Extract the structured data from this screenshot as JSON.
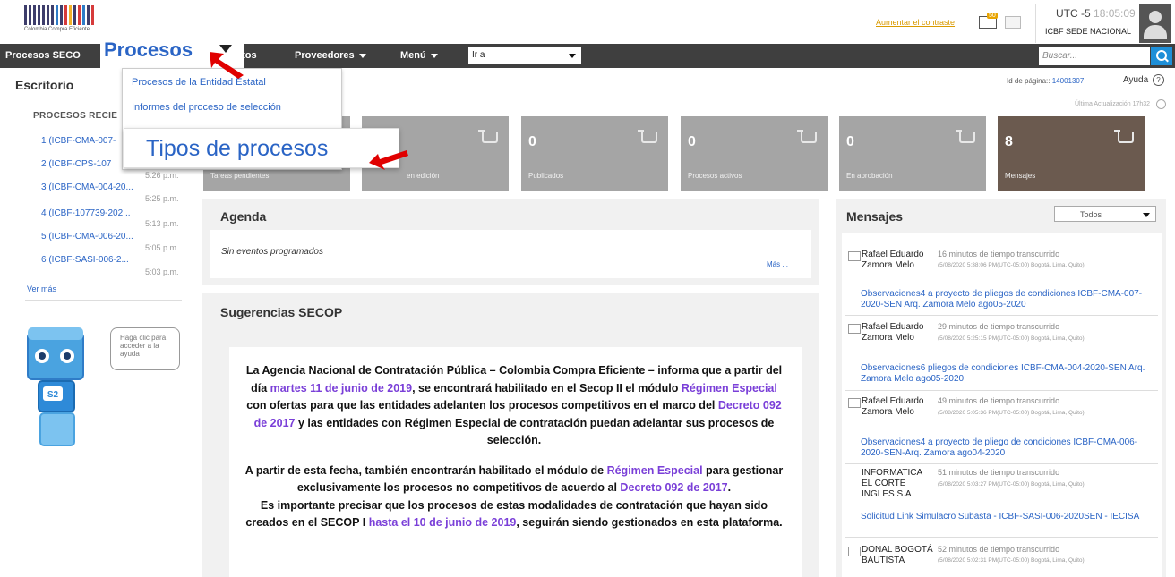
{
  "header": {
    "logo_caption": "Colombia Compra Eficiente",
    "increase_link": "Aumentar el contraste",
    "notif_badge": "50",
    "clock_main": "UTC -5",
    "clock_seconds": "18:05:09",
    "org_name": "ICBF SEDE NACIONAL"
  },
  "navbar": {
    "item_procesos_secop": "Procesos SECO",
    "item_contratos": "atos",
    "item_proveedores": "Proveedores",
    "item_menu": "Menú",
    "goto_value": "Ir a",
    "search_placeholder": "Buscar..."
  },
  "dropdown": {
    "tab_label": "Procesos",
    "items": [
      "Procesos de la Entidad Estatal",
      "Informes del proceso de selección"
    ],
    "highlight_item": "Tipos de procesos"
  },
  "sidebar": {
    "title": "Escritorio",
    "recent_title": "PROCESOS RECIE",
    "recent": [
      {
        "label": "1 (ICBF-CMA-007-",
        "time": ""
      },
      {
        "label": "2 (ICBF-CPS-107",
        "time": "5:26 p.m."
      },
      {
        "label": "3 (ICBF-CMA-004-20...",
        "time": "5:25 p.m."
      },
      {
        "label": "4 (ICBF-107739-202...",
        "time": "5:13 p.m."
      },
      {
        "label": "5 (ICBF-CMA-006-20...",
        "time": "5:05 p.m."
      },
      {
        "label": "6 (ICBF-SASI-006-2...",
        "time": "5:03 p.m."
      }
    ],
    "see_more": "Ver más",
    "help_bubble": "Haga clic para acceder a la ayuda",
    "robot_badge": "S2"
  },
  "page_meta": {
    "page_id_label": "Id de página::",
    "page_id_value": "14001307",
    "help_label": "Ayuda",
    "last_update": "Última Actualización 17h32"
  },
  "tiles": [
    {
      "num": "",
      "label": "Tareas pendientes"
    },
    {
      "num": "",
      "label": "en edición"
    },
    {
      "num": "0",
      "label": "Publicados"
    },
    {
      "num": "0",
      "label": "Procesos activos"
    },
    {
      "num": "0",
      "label": "En aprobación"
    },
    {
      "num": "8",
      "label": "Mensajes"
    }
  ],
  "agenda": {
    "title": "Agenda",
    "empty": "Sin eventos programados",
    "more": "Más ..."
  },
  "suggestions": {
    "title": "Sugerencias SECOP",
    "p1_a": "La Agencia Nacional de Contratación Pública – Colombia Compra Eficiente – informa que a partir del día ",
    "p1_h1": "martes 11 de junio de 2019",
    "p1_b": ", se encontrará habilitado en el Secop II el módulo ",
    "p1_h2": "Régimen Especial",
    "p1_c": " con ofertas para que las entidades adelanten los procesos competitivos en el marco del ",
    "p1_h3": "Decreto 092 de 2017",
    "p1_d": " y las entidades con Régimen Especial de contratación puedan adelantar sus procesos de selección.",
    "p2_a": "A partir de esta fecha, también encontrarán habilitado el módulo de ",
    "p2_h1": "Régimen Especial",
    "p2_b": " para gestionar exclusivamente los procesos no competitivos de acuerdo al ",
    "p2_h2": "Decreto 092 de 2017",
    "p2_c": ".",
    "p3_a": "Es importante precisar que los procesos de estas modalidades de contratación que hayan sido creados en el SECOP I ",
    "p3_h1": "hasta el 10 de junio de 2019",
    "p3_b": ", seguirán siendo gestionados en esta plataforma."
  },
  "messages": {
    "title": "Mensajes",
    "filter": "Todos",
    "items": [
      {
        "sender": "Rafael Eduardo Zamora Melo",
        "elapsed": "16 minutos de tiempo transcurrido",
        "date": "(5/08/2020 5:38:06 PM(UTC-05:00) Bogotá, Lima, Quito)",
        "subject": "Observaciones4 a proyecto de pliegos de condiciones ICBF-CMA-007-2020-SEN Arq. Zamora Melo ago05-2020"
      },
      {
        "sender": "Rafael Eduardo Zamora Melo",
        "elapsed": "29 minutos de tiempo transcurrido",
        "date": "(5/08/2020 5:25:15 PM(UTC-05:00) Bogotá, Lima, Quito)",
        "subject": "Observaciones6 pliegos de condiciones ICBF-CMA-004-2020-SEN Arq. Zamora Melo ago05-2020"
      },
      {
        "sender": "Rafael Eduardo Zamora Melo",
        "elapsed": "49 minutos de tiempo transcurrido",
        "date": "(5/08/2020 5:05:36 PM(UTC-05:00) Bogotá, Lima, Quito)",
        "subject": "Observaciones4 a proyecto de pliego de condiciones ICBF-CMA-006-2020-SEN-Arq. Zamora ago04-2020"
      },
      {
        "sender": "INFORMATICA EL CORTE INGLES S.A",
        "elapsed": "51 minutos de tiempo transcurrido",
        "date": "(5/08/2020 5:03:27 PM(UTC-05:00) Bogotá, Lima, Quito)",
        "subject": "Solicitud Link Simulacro Subasta - ICBF-SASI-006-2020SEN - IECISA"
      },
      {
        "sender": "DONAL BOGOTÁ BAUTISTA",
        "elapsed": "52 minutos de tiempo transcurrido",
        "date": "(5/08/2020 5:02:31 PM(UTC-05:00) Bogotá, Lima, Quito)",
        "subject": ""
      }
    ]
  },
  "colors": {
    "nav_bg": "#3f3f3f",
    "link": "#2a64c5",
    "tile_gray": "#a5a5a5",
    "tile_messages": "#6b5a4f",
    "arrow_red": "#e00000",
    "highlight_purple": "#7a3fd8"
  }
}
